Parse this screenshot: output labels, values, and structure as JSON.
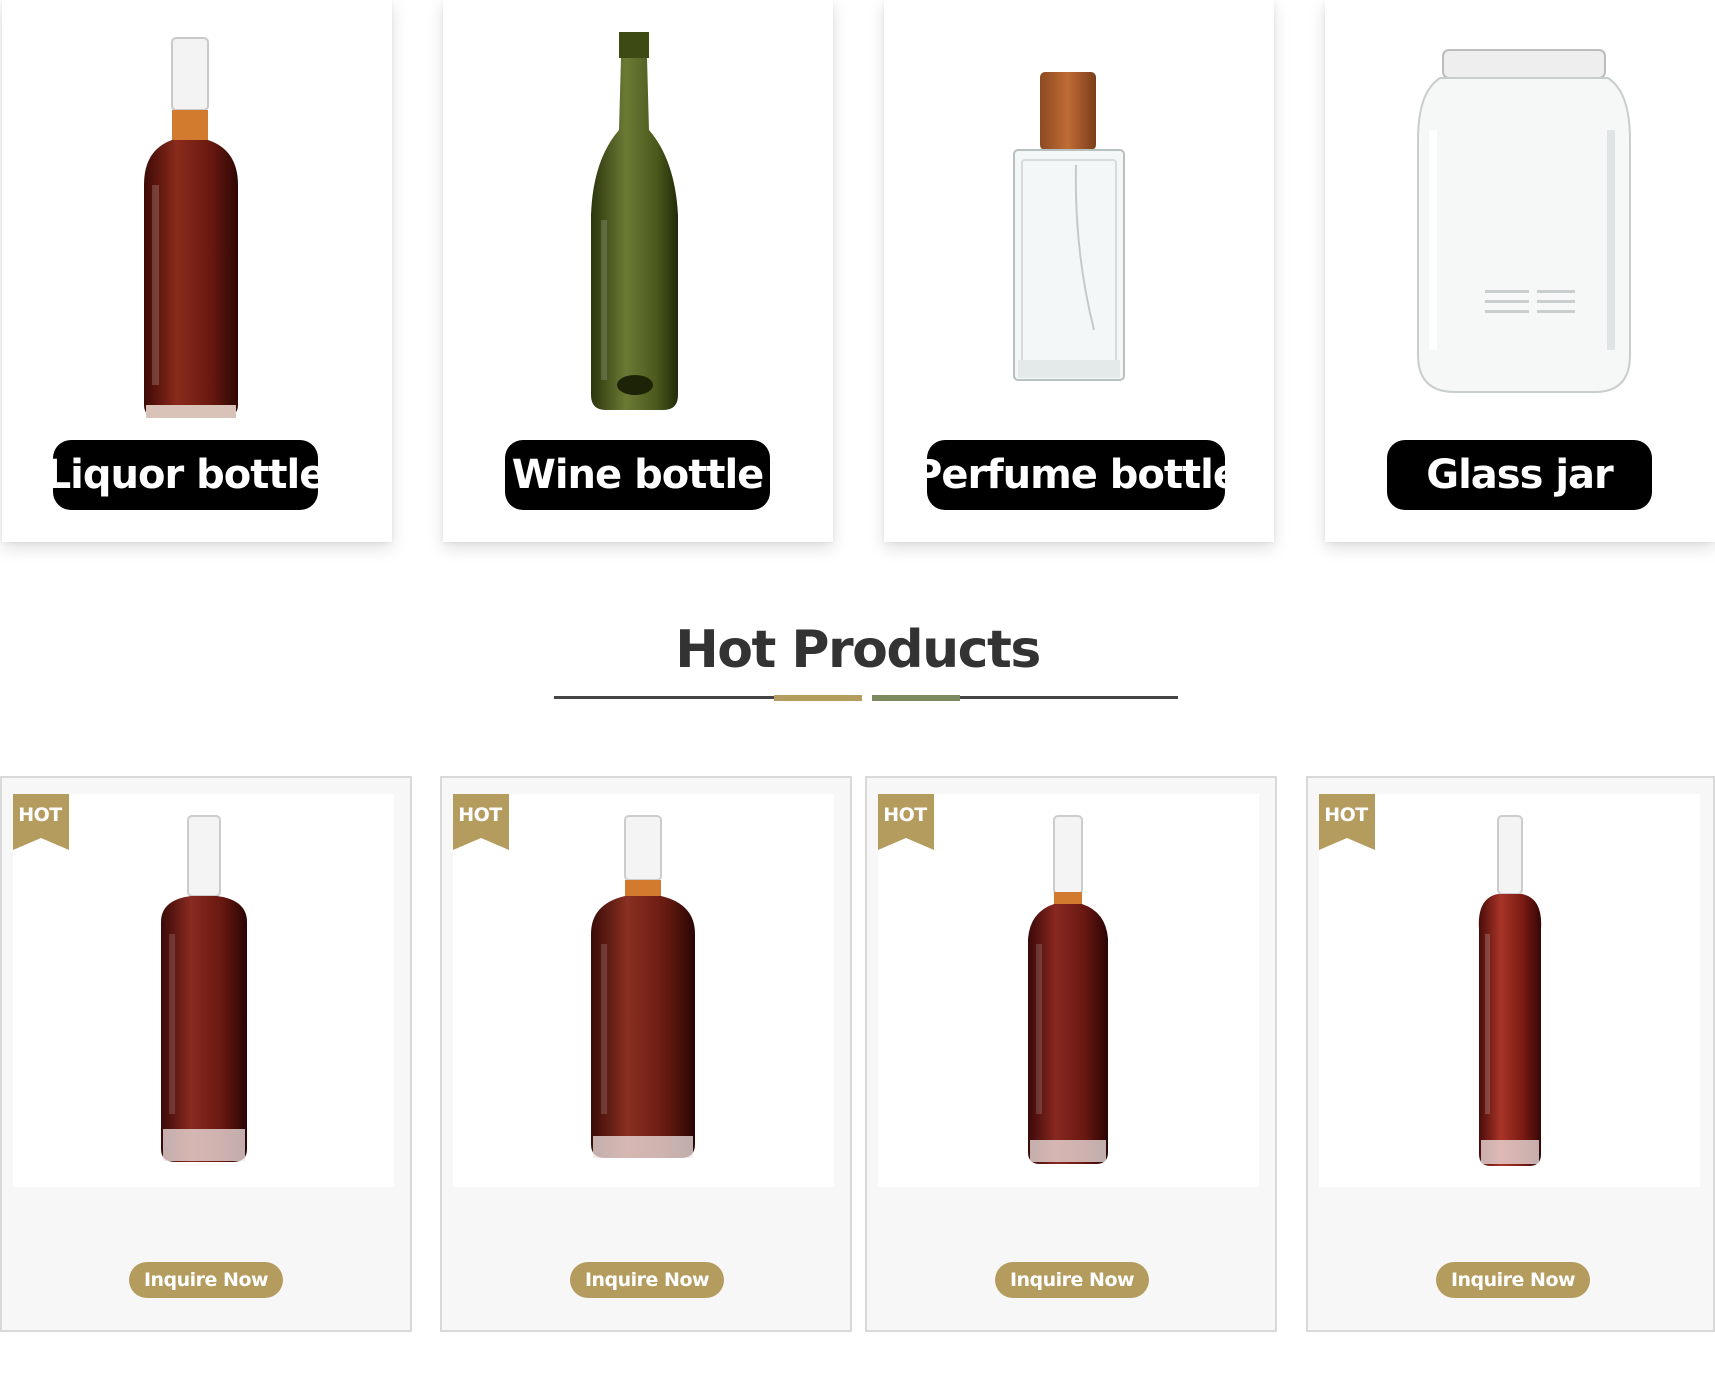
{
  "categories": [
    {
      "label": "Liquor bottle"
    },
    {
      "label": "Wine bottle"
    },
    {
      "label": "Perfume bottle"
    },
    {
      "label": "Glass jar"
    }
  ],
  "hot_products": {
    "title": "Hot Products",
    "items": [
      {
        "badge": "HOT",
        "button": "Inquire Now"
      },
      {
        "badge": "HOT",
        "button": "Inquire Now"
      },
      {
        "badge": "HOT",
        "button": "Inquire Now"
      },
      {
        "badge": "HOT",
        "button": "Inquire Now"
      }
    ]
  },
  "colors": {
    "pill_bg": "#000000",
    "accent_gold": "#b49b5e",
    "accent_green": "#7d8a60",
    "liquor": "#7a1f16",
    "wine_glass": "#4c5c1e"
  }
}
